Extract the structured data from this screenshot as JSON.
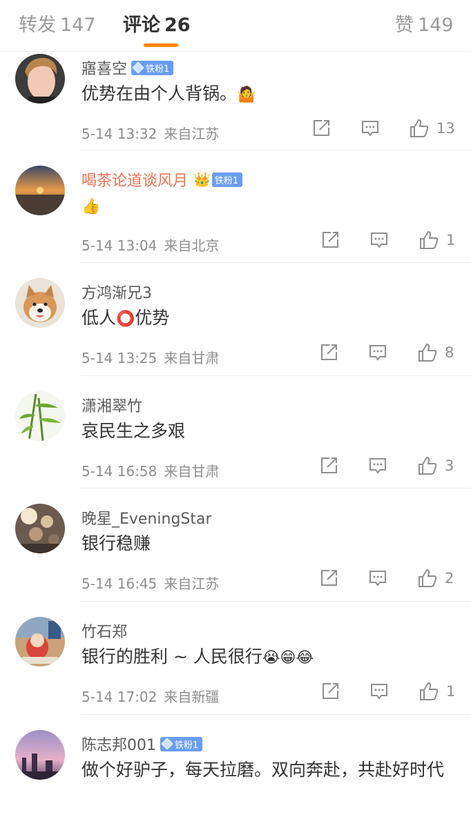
{
  "tabs": [
    {
      "label": "转发",
      "count": "147"
    },
    {
      "label": "评论",
      "count": "26"
    },
    {
      "label": "赞",
      "count": "149"
    }
  ],
  "comments": [
    {
      "user": "寤喜空",
      "badge": "铁粉1",
      "text": "优势在由个人背锅。",
      "emoji": "🤷",
      "time": "5-14 13:32",
      "source": "来自江苏",
      "likes": "13"
    },
    {
      "user": "喝茶论道谈风月",
      "badge": "铁粉1",
      "crown": "👑",
      "text": "",
      "emoji": "👍",
      "time": "5-14 13:04",
      "source": "来自北京",
      "likes": "1"
    },
    {
      "user": "方鸿渐兄3",
      "text": "低人",
      "emoji": "⭕",
      "text2": "优势",
      "time": "5-14 13:25",
      "source": "来自甘肃",
      "likes": "8"
    },
    {
      "user": "潇湘翠竹",
      "text": "哀民生之多艰",
      "time": "5-14 16:58",
      "source": "来自甘肃",
      "likes": "3"
    },
    {
      "user": "晚星_EveningStar",
      "text": "银行稳赚",
      "time": "5-14 16:45",
      "source": "来自江苏",
      "likes": "2"
    },
    {
      "user": "竹石郑",
      "text": "银行的胜利 ~ 人民很行",
      "emoji": "😭😁😂",
      "time": "5-14 17:02",
      "source": "来自新疆",
      "likes": "1"
    },
    {
      "user": "陈志邦001",
      "badge": "铁粉1",
      "text": "做个好驴子，每天拉磨。双向奔赴，共赴好时代"
    }
  ],
  "colors": {
    "accent": "#ff8200",
    "orange_name": "#eb7350",
    "badge": "#6a9df3",
    "meta_text": "#8e8e8e"
  },
  "icons": {
    "repost": "share-box-icon",
    "comment": "comment-bubble-icon",
    "like": "thumbs-up-icon"
  }
}
